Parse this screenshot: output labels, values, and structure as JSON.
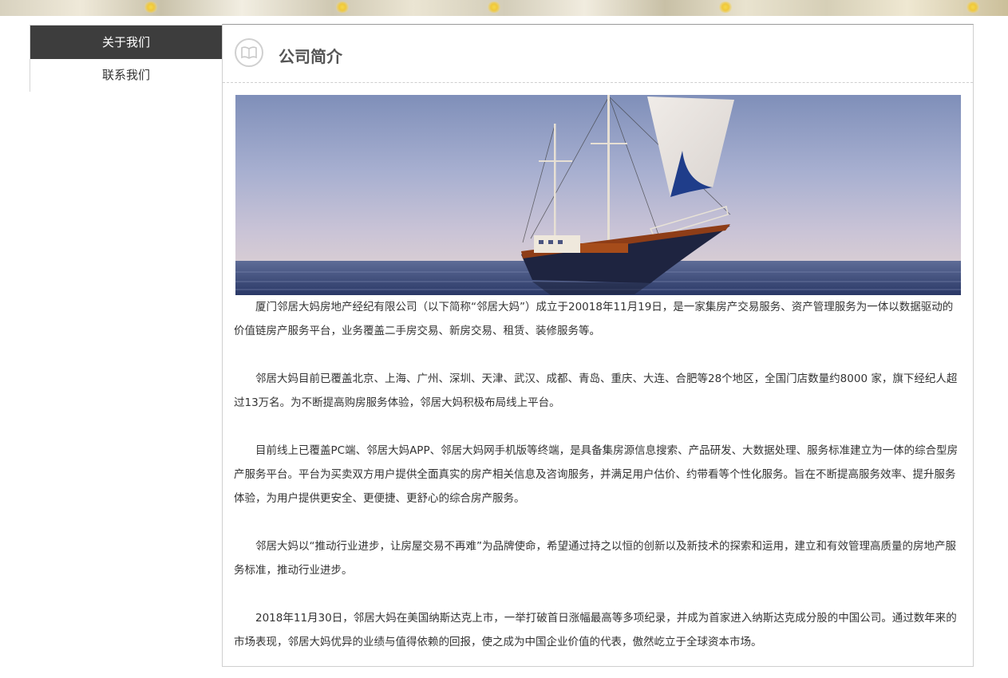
{
  "sidebar": {
    "items": [
      {
        "label": "关于我们",
        "active": true
      },
      {
        "label": "联系我们",
        "active": false
      }
    ]
  },
  "header": {
    "icon": "book-icon",
    "title": "公司简介"
  },
  "hero_image": {
    "subject": "sailboat-on-sea"
  },
  "content": {
    "paragraphs": [
      "厦门邻居大妈房地产经纪有限公司（以下简称“邻居大妈”）成立于20018年11月19日，是一家集房产交易服务、资产管理服务为一体以数据驱动的价值链房产服务平台，业务覆盖二手房交易、新房交易、租赁、装修服务等。",
      "邻居大妈目前已覆盖北京、上海、广州、深圳、天津、武汉、成都、青岛、重庆、大连、合肥等28个地区，全国门店数量约8000 家，旗下经纪人超过13万名。为不断提高购房服务体验，邻居大妈积极布局线上平台。",
      "目前线上已覆盖PC端、邻居大妈APP、邻居大妈网手机版等终端，是具备集房源信息搜索、产品研发、大数据处理、服务标准建立为一体的综合型房产服务平台。平台为买卖双方用户提供全面真实的房产相关信息及咨询服务，并满足用户估价、约带看等个性化服务。旨在不断提高服务效率、提升服务体验，为用户提供更安全、更便捷、更舒心的综合房产服务。",
      "邻居大妈以“推动行业进步，让房屋交易不再难”为品牌使命，希望通过持之以恒的创新以及新技术的探索和运用，建立和有效管理高质量的房地产服务标准，推动行业进步。",
      "2018年11月30日，邻居大妈在美国纳斯达克上市，一举打破首日涨幅最高等多项纪录，并成为首家进入纳斯达克成分股的中国公司。通过数年来的市场表现，邻居大妈优异的业绩与值得依赖的回报，使之成为中国企业价值的代表，傲然屹立于全球资本市场。"
    ]
  }
}
